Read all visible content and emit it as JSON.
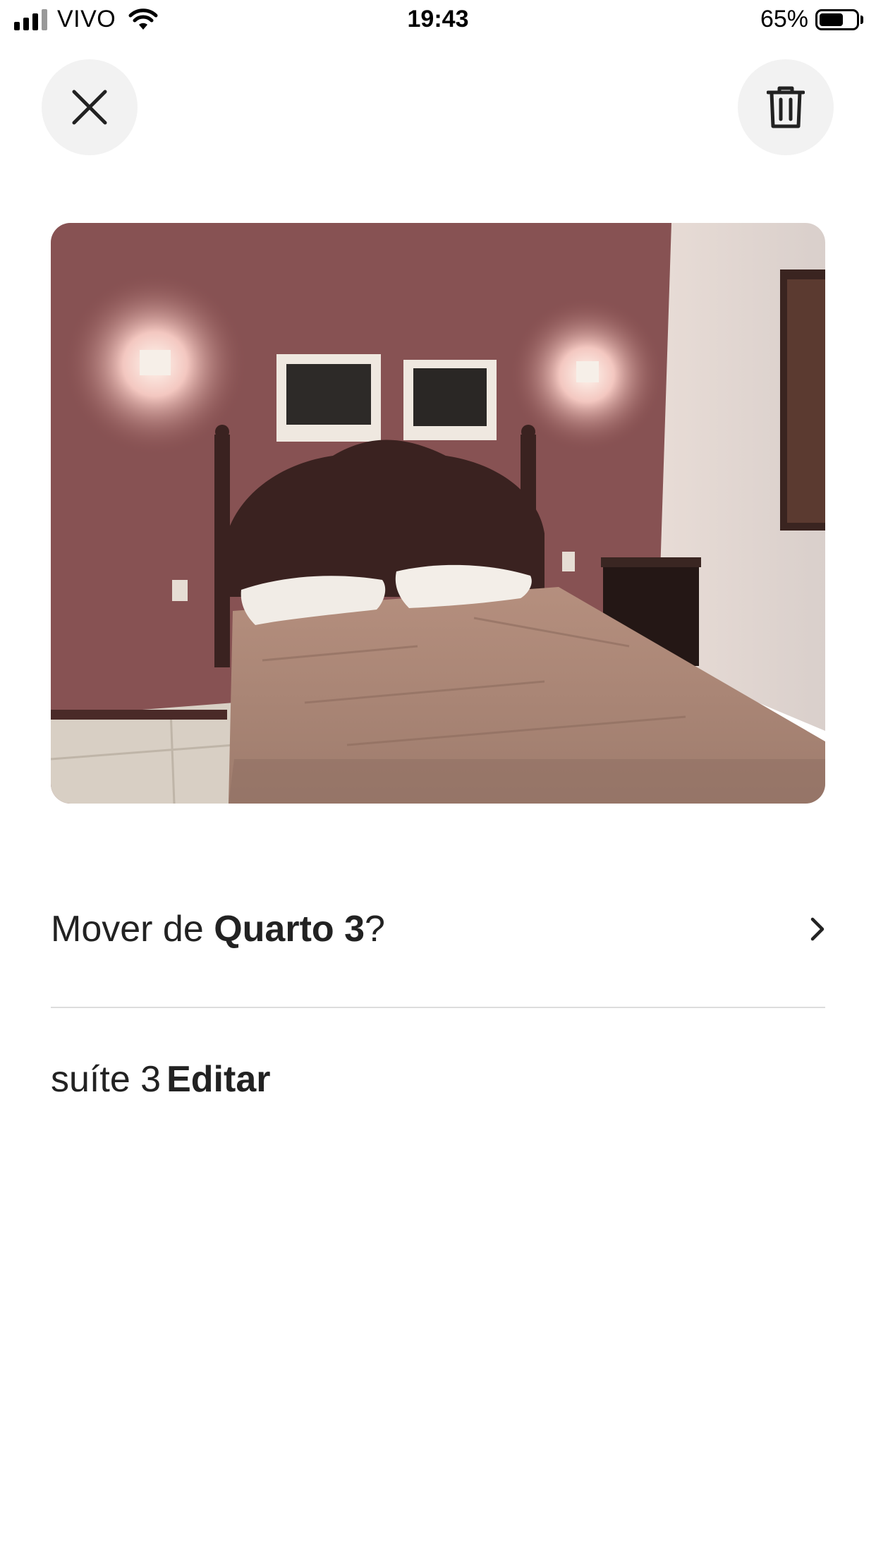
{
  "status_bar": {
    "carrier": "VIVO",
    "time": "19:43",
    "battery_percent": "65%",
    "battery_level": 0.65
  },
  "header": {
    "close_icon": "close-icon",
    "delete_icon": "trash-icon"
  },
  "photo": {
    "subject": "bedroom-photo"
  },
  "move": {
    "prefix": "Mover de ",
    "room": "Quarto 3",
    "suffix": "?",
    "chevron_icon": "chevron-right-icon"
  },
  "caption": {
    "text": "suíte 3",
    "edit_label": "Editar"
  },
  "colors": {
    "background": "#ffffff",
    "button_bg": "#f2f2f2",
    "text": "#222222",
    "divider": "#dddddd"
  }
}
